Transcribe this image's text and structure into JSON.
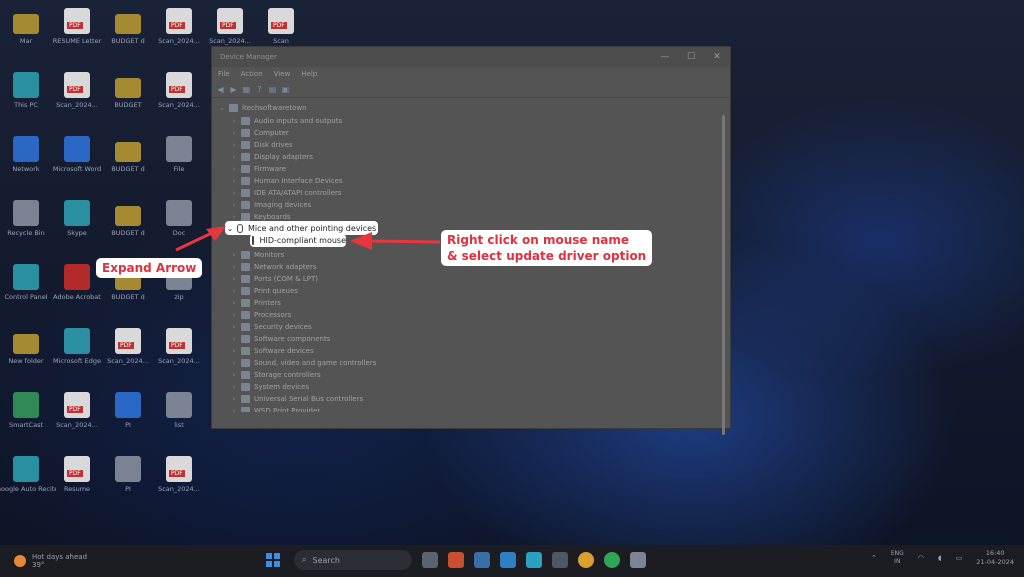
{
  "desktop_icons": [
    {
      "col": 0,
      "row": 0,
      "kind": "folder",
      "caption": "Mar"
    },
    {
      "col": 1,
      "row": 0,
      "kind": "pdf",
      "caption": "RESUME Letter"
    },
    {
      "col": 2,
      "row": 0,
      "kind": "folder",
      "caption": "BUDGET d"
    },
    {
      "col": 3,
      "row": 0,
      "kind": "pdf",
      "caption": "Scan_2024..."
    },
    {
      "col": 4,
      "row": 0,
      "kind": "pdf",
      "caption": "Scan_2024..."
    },
    {
      "col": 5,
      "row": 0,
      "kind": "pdf",
      "caption": "Scan"
    },
    {
      "col": 0,
      "row": 1,
      "kind": "teal",
      "caption": "This PC"
    },
    {
      "col": 1,
      "row": 1,
      "kind": "pdf",
      "caption": "Scan_2024..."
    },
    {
      "col": 2,
      "row": 1,
      "kind": "folder",
      "caption": "BUDGET"
    },
    {
      "col": 3,
      "row": 1,
      "kind": "pdf",
      "caption": "Scan_2024..."
    },
    {
      "col": 0,
      "row": 2,
      "kind": "blue",
      "caption": "Network"
    },
    {
      "col": 1,
      "row": 2,
      "kind": "blue",
      "caption": "Microsoft Word"
    },
    {
      "col": 2,
      "row": 2,
      "kind": "folder",
      "caption": "BUDGET d"
    },
    {
      "col": 3,
      "row": 2,
      "kind": "gray",
      "caption": "File"
    },
    {
      "col": 0,
      "row": 3,
      "kind": "gray",
      "caption": "Recycle Bin"
    },
    {
      "col": 1,
      "row": 3,
      "kind": "teal",
      "caption": "Skype"
    },
    {
      "col": 2,
      "row": 3,
      "kind": "folder",
      "caption": "BUDGET d"
    },
    {
      "col": 3,
      "row": 3,
      "kind": "gray",
      "caption": "Doc"
    },
    {
      "col": 0,
      "row": 4,
      "kind": "teal",
      "caption": "Control Panel"
    },
    {
      "col": 1,
      "row": 4,
      "kind": "red",
      "caption": "Adobe Acrobat"
    },
    {
      "col": 2,
      "row": 4,
      "kind": "folder",
      "caption": "BUDGET d"
    },
    {
      "col": 3,
      "row": 4,
      "kind": "gray",
      "caption": "zip"
    },
    {
      "col": 0,
      "row": 5,
      "kind": "folder",
      "caption": "New folder"
    },
    {
      "col": 1,
      "row": 5,
      "kind": "teal",
      "caption": "Microsoft Edge"
    },
    {
      "col": 2,
      "row": 5,
      "kind": "pdf",
      "caption": "Scan_2024..."
    },
    {
      "col": 3,
      "row": 5,
      "kind": "pdf",
      "caption": "Scan_2024..."
    },
    {
      "col": 0,
      "row": 6,
      "kind": "green",
      "caption": "SmartCast"
    },
    {
      "col": 1,
      "row": 6,
      "kind": "pdf",
      "caption": "Scan_2024..."
    },
    {
      "col": 2,
      "row": 6,
      "kind": "blue",
      "caption": "PI"
    },
    {
      "col": 3,
      "row": 6,
      "kind": "gray",
      "caption": "list"
    },
    {
      "col": 0,
      "row": 7,
      "kind": "teal",
      "caption": "Google Auto Recite"
    },
    {
      "col": 1,
      "row": 7,
      "kind": "pdf",
      "caption": "Resume"
    },
    {
      "col": 2,
      "row": 7,
      "kind": "gray",
      "caption": "PI"
    },
    {
      "col": 3,
      "row": 7,
      "kind": "pdf",
      "caption": "Scan_2024..."
    }
  ],
  "window": {
    "title": "Device Manager",
    "menu": [
      "File",
      "Action",
      "View",
      "Help"
    ],
    "root": "itechsoftwaretown",
    "tree_before": [
      "Audio inputs and outputs",
      "Computer",
      "Disk drives",
      "Display adapters",
      "Firmware",
      "Human Interface Devices",
      "IDE ATA/ATAPI controllers",
      "Imaging devices",
      "Keyboards"
    ],
    "expanded_category": "Mice and other pointing devices",
    "expanded_child": "HID-compliant mouse",
    "tree_after": [
      "Monitors",
      "Network adapters",
      "Ports (COM & LPT)",
      "Print queues",
      "Printers",
      "Processors",
      "Security devices",
      "Software components",
      "Software devices",
      "Sound, video and game controllers",
      "Storage controllers",
      "System devices",
      "Universal Serial Bus controllers",
      "WSD Print Provider"
    ]
  },
  "callouts": {
    "expand_arrow": "Expand Arrow",
    "right_click_line1": "Right click on mouse name",
    "right_click_line2": "& select update driver option"
  },
  "colors": {
    "callout_text": "#e0313f",
    "arrow": "#e8363e"
  },
  "taskbar": {
    "weather_line1": "Hot days ahead",
    "weather_line2": "39°",
    "search_placeholder": "Search",
    "lang_line1": "ENG",
    "lang_line2": "IN",
    "time": "16:40",
    "date": "21-04-2024"
  }
}
